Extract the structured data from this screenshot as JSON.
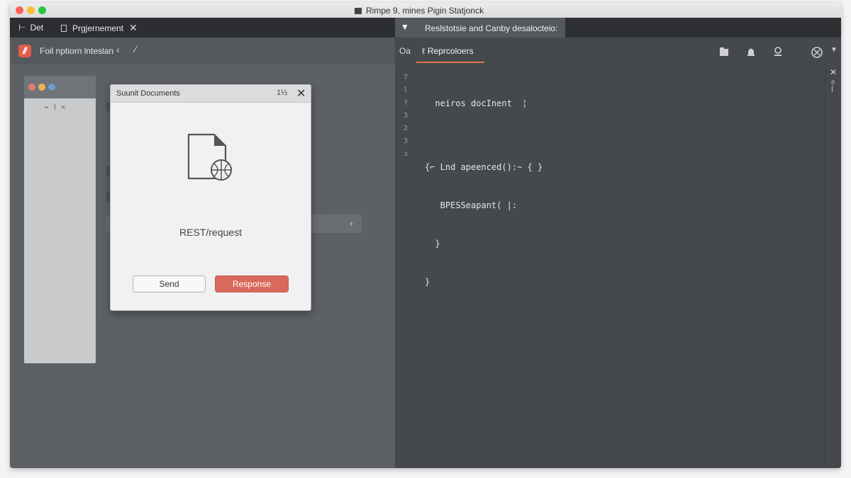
{
  "window": {
    "title": "Rimpe 9, mines Pigin Statjonck"
  },
  "left": {
    "tabs": [
      {
        "label": "Det"
      },
      {
        "label": "Prgjernement"
      }
    ],
    "toolbar": {
      "label": "Foil nptiorn lnteslan"
    }
  },
  "dialog": {
    "title": "Suunit Documents",
    "extra": "1½",
    "close": "✕",
    "label": "REST/request",
    "send_label": "Send",
    "response_label": "Response"
  },
  "right": {
    "tab_label": "Reslstotsie and Canby desalocteio:",
    "toolbar": {
      "prefix": "Oa",
      "tab_label": "Reprcoloers"
    },
    "gutter": [
      "7",
      "l",
      "?",
      "3",
      "2",
      "3",
      "ɔ"
    ],
    "code": [
      "  neiros docInent  ¦",
      "",
      "{⌐ Lnd apeenced():~ { }",
      "   BPESSeapant( |:",
      "  }",
      "}"
    ]
  },
  "colors": {
    "accent": "#d96a5b",
    "tab_underline": "#e2734a"
  },
  "icons": [
    "git-icon",
    "back-chevron-icon",
    "brush-icon",
    "dropdown-triangle-icon",
    "file-icon",
    "save-icon",
    "bell-icon",
    "user-icon",
    "settings-icon",
    "chevron-down-icon",
    "close-icon"
  ]
}
